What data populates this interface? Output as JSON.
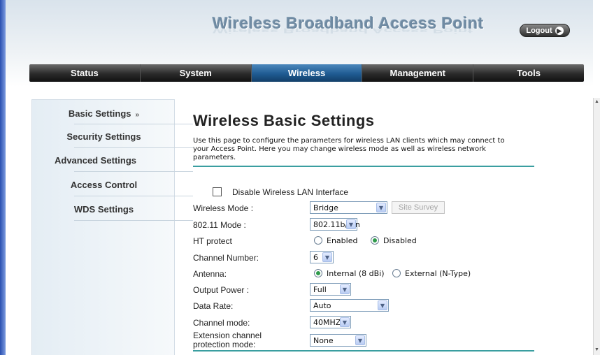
{
  "header": {
    "title": "Wireless Broadband Access Point",
    "logout_label": "Logout"
  },
  "nav": {
    "tabs": [
      "Status",
      "System",
      "Wireless",
      "Management",
      "Tools"
    ],
    "active": "Wireless"
  },
  "sidebar": {
    "items": [
      "Basic Settings",
      "Security Settings",
      "Advanced Settings",
      "Access Control",
      "WDS Settings"
    ],
    "active_marker": "»"
  },
  "main": {
    "title": "Wireless Basic Settings",
    "description": "Use this page to configure the parameters for wireless LAN clients which may connect to your Access Point. Here you may change wireless mode as well as wireless network parameters.",
    "disable_label": "Disable Wireless LAN Interface",
    "fields": {
      "wireless_mode": {
        "label": "Wireless Mode :",
        "value": "Bridge",
        "button": "Site Survey"
      },
      "mode_80211": {
        "label": "802.11 Mode :",
        "value": "802.11b/g/n"
      },
      "ht_protect": {
        "label": "HT protect",
        "option1": "Enabled",
        "option2": "Disabled"
      },
      "channel_number": {
        "label": "Channel Number:",
        "value": "6"
      },
      "antenna": {
        "label": "Antenna:",
        "option1": "Internal (8 dBi)",
        "option2": "External (N-Type)"
      },
      "output_power": {
        "label": "Output Power :",
        "value": "Full"
      },
      "data_rate": {
        "label": "Data Rate:",
        "value": "Auto"
      },
      "channel_mode": {
        "label": "Channel mode:",
        "value": "40MHZ"
      },
      "ext_protection": {
        "label_line1": "Extension channel",
        "label_line2": "protection mode:",
        "value": "None"
      }
    }
  },
  "colors": {
    "nav_active": "#1f5b92",
    "rule": "#3a9ea0",
    "radio_on": "#2e9a4a"
  }
}
